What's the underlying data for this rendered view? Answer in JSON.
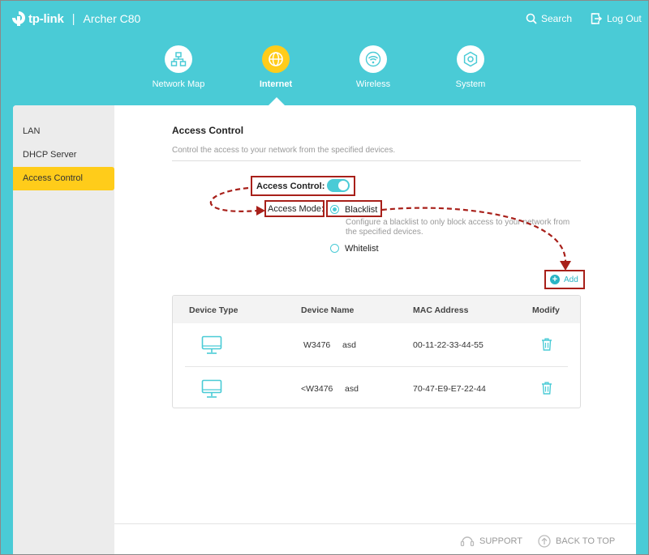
{
  "header": {
    "brand": "tp-link",
    "separator": "|",
    "model": "Archer C80",
    "search_label": "Search",
    "logout_label": "Log Out"
  },
  "nav": [
    {
      "label": "Network Map",
      "icon": "network-map-icon"
    },
    {
      "label": "Internet",
      "icon": "globe-icon",
      "active": true
    },
    {
      "label": "Wireless",
      "icon": "wifi-icon"
    },
    {
      "label": "System",
      "icon": "gear-icon"
    }
  ],
  "sidebar": {
    "items": [
      {
        "label": "LAN"
      },
      {
        "label": "DHCP Server"
      },
      {
        "label": "Access Control",
        "active": true
      }
    ]
  },
  "main": {
    "title": "Access Control",
    "subtitle": "Control the access to your network from the specified devices.",
    "access_control_label": "Access Control:",
    "access_control_enabled": true,
    "access_mode_label": "Access Mode:",
    "blacklist_label": "Blacklist",
    "blacklist_desc": "Configure a blacklist to only block access to your network from the specified devices.",
    "whitelist_label": "Whitelist",
    "selected_mode": "Blacklist",
    "add_label": "Add"
  },
  "table": {
    "headers": [
      "Device Type",
      "Device Name",
      "MAC Address",
      "Modify"
    ],
    "rows": [
      {
        "device_icon": "monitor-icon",
        "name": "W3476",
        "name_suffix": "asd",
        "mac": "00-11-22-33-44-55",
        "action_icon": "trash-icon"
      },
      {
        "device_icon": "monitor-icon",
        "name": "<W3476",
        "name_suffix": "asd",
        "mac": "70-47-E9-E7-22-44",
        "action_icon": "trash-icon"
      }
    ]
  },
  "footer": {
    "support_label": "SUPPORT",
    "back_to_top_label": "BACK TO TOP"
  },
  "colors": {
    "header_bg": "#4acbd6",
    "accent_yellow": "#ffcc1a",
    "highlight_red": "#a8201a",
    "link_teal": "#2ab4c5"
  }
}
